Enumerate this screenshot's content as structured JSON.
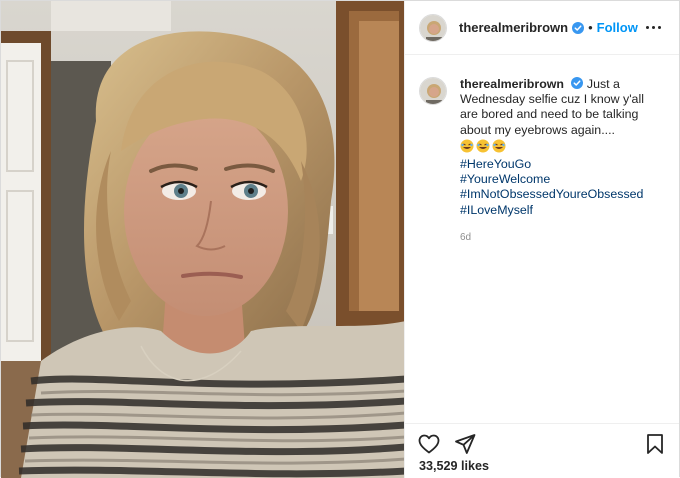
{
  "post": {
    "username": "therealmeribrown",
    "dot": "•",
    "follow_label": "Follow",
    "caption_text": "Just a Wednesday selfie cuz I know y'all are bored and need to be talking about my eyebrows again....",
    "hashtags": [
      "#HereYouGo",
      "#YoureWelcome",
      "#ImNotObsessedYoureObsessed",
      "#ILoveMyself"
    ],
    "emoji_icons": [
      "rofl-emoji-icon",
      "rofl-emoji-icon",
      "rofl-emoji-icon"
    ],
    "time_ago": "6d",
    "likes": "33,529 likes"
  },
  "icons": {
    "verified": "verified-badge-icon",
    "more": "more-options-icon",
    "like": "heart-icon",
    "share": "paper-plane-icon",
    "save": "bookmark-icon"
  },
  "colors": {
    "accent": "#0095f6",
    "hashtag": "#00376b",
    "muted": "#8e8e8e",
    "verified": "#3897f0"
  }
}
